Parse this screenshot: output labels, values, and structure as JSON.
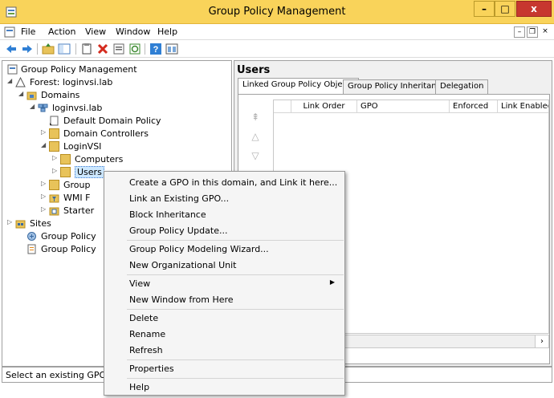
{
  "window": {
    "title": "Group Policy Management",
    "min_label": "–",
    "max_label": "□",
    "close_label": "x"
  },
  "menubar": {
    "items": [
      "File",
      "Action",
      "View",
      "Window",
      "Help"
    ],
    "mdi_min": "–",
    "mdi_restore": "❐",
    "mdi_close": "×"
  },
  "toolbar": {
    "icons": [
      "back-icon",
      "forward-icon",
      "up-folder-icon",
      "show-hide-tree-icon",
      "copy-icon",
      "delete-icon",
      "properties-icon",
      "refresh-icon",
      "help-icon",
      "view-icon"
    ]
  },
  "tree": {
    "root": "Group Policy Management",
    "forest": "Forest: loginvsi.lab",
    "domains": "Domains",
    "domain": "loginvsi.lab",
    "default_policy": "Default Domain Policy",
    "domain_controllers": "Domain Controllers",
    "loginvsi": "LoginVSI",
    "computers": "Computers",
    "users": "Users",
    "group_policy_objects": "Group",
    "wmi_filters": "WMI F",
    "starter_gpos": "Starter",
    "sites": "Sites",
    "modeling": "Group Policy",
    "results": "Group Policy"
  },
  "right_pane": {
    "title": "Users",
    "tabs": [
      "Linked Group Policy Objects",
      "Group Policy Inheritance",
      "Delegation"
    ],
    "columns": [
      "Link Order",
      "GPO",
      "Enforced",
      "Link Enabled"
    ],
    "scroll_right": "›"
  },
  "context_menu": {
    "items": [
      "Create a GPO in this domain, and Link it here...",
      "Link an Existing GPO...",
      "Block Inheritance",
      "Group Policy Update...",
      "Group Policy Modeling Wizard...",
      "New Organizational Unit",
      "View",
      "New Window from Here",
      "Delete",
      "Rename",
      "Refresh",
      "Properties",
      "Help"
    ],
    "submenu_arrow": "▶"
  },
  "statusbar": {
    "text": "Select an existing GPO an"
  },
  "colors": {
    "titlebar": "#f9d35a",
    "close_button": "#c7372f",
    "selection": "#cde8ff"
  }
}
